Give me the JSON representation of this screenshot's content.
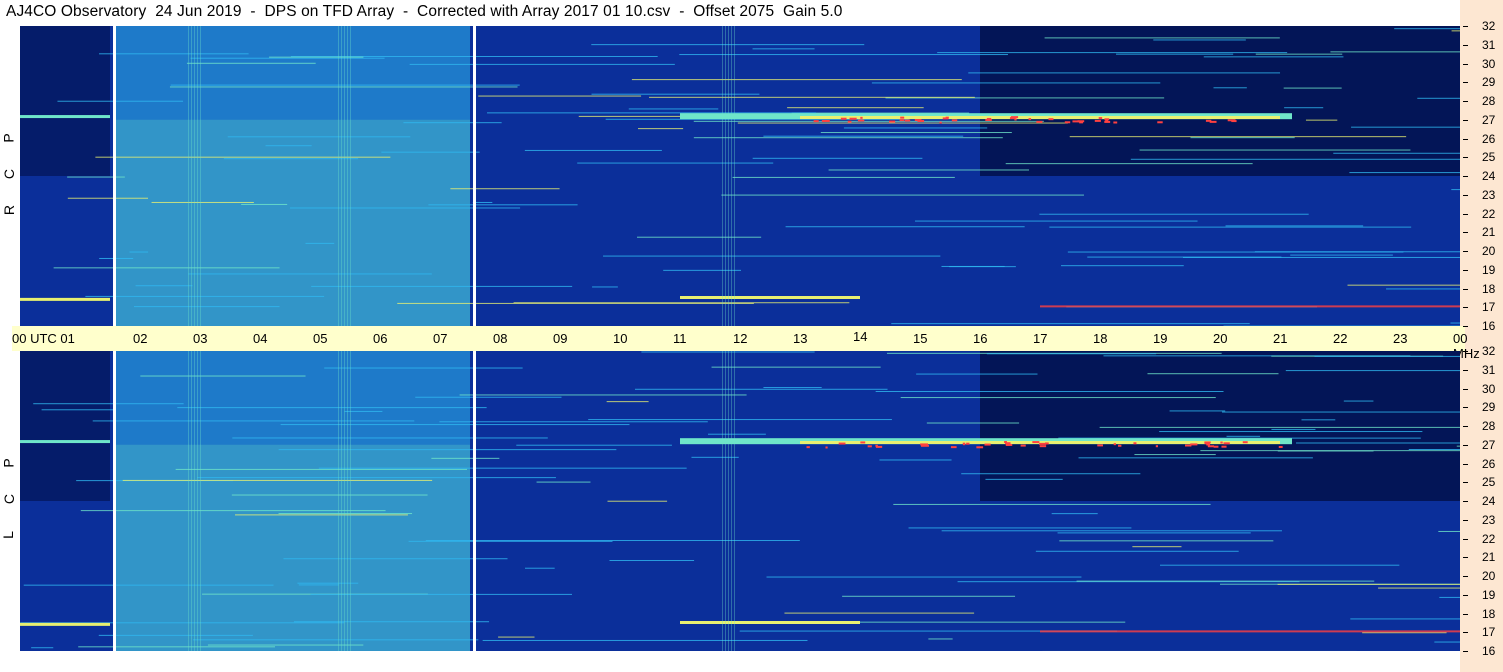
{
  "title": "AJ4CO Observatory  24 Jun 2019  -  DPS on TFD Array  -  Corrected with Array 2017 01 10.csv  -  Offset 2075  Gain 5.0",
  "colors": {
    "background": "#ffffff",
    "axis_strip": "#ffffcc",
    "freq_strip": "#fde7d2",
    "colormap": [
      "#000a3a",
      "#0b2f9a",
      "#1f6fe0",
      "#2fb8f0",
      "#6fe6c9",
      "#e8f070",
      "#ff4040"
    ]
  },
  "panels": {
    "rcp": {
      "label": [
        "R",
        "C",
        "P"
      ]
    },
    "lcp": {
      "label": [
        "L",
        "C",
        "P"
      ]
    }
  },
  "time_axis": {
    "labels": [
      "00 UTC 01",
      "02",
      "03",
      "04",
      "05",
      "06",
      "07",
      "08",
      "09",
      "10",
      "11",
      "12",
      "13",
      "14",
      "15",
      "16",
      "17",
      "18",
      "19",
      "20",
      "21",
      "22",
      "23",
      "00 MHz"
    ]
  },
  "freq_axis": {
    "labels": [
      "32",
      "31",
      "30",
      "29",
      "28",
      "27",
      "26",
      "25",
      "24",
      "23",
      "22",
      "21",
      "20",
      "19",
      "18",
      "17",
      "16"
    ]
  },
  "chart_data": {
    "type": "heatmap",
    "title": "AJ4CO Observatory  24 Jun 2019  -  DPS on TFD Array  -  Corrected with Array 2017 01 10.csv  -  Offset 2075  Gain 5.0",
    "x": {
      "unit": "UTC hour",
      "range": [
        0,
        24
      ],
      "ticks": [
        "00",
        "01",
        "02",
        "03",
        "04",
        "05",
        "06",
        "07",
        "08",
        "09",
        "10",
        "11",
        "12",
        "13",
        "14",
        "15",
        "16",
        "17",
        "18",
        "19",
        "20",
        "21",
        "22",
        "23",
        "00"
      ]
    },
    "y": {
      "unit": "MHz",
      "range": [
        16,
        32
      ],
      "ticks": [
        16,
        17,
        18,
        19,
        20,
        21,
        22,
        23,
        24,
        25,
        26,
        27,
        28,
        29,
        30,
        31,
        32
      ]
    },
    "panels": [
      {
        "name": "RCP"
      },
      {
        "name": "LCP"
      }
    ],
    "features": {
      "bright_band_mhz": 27.1,
      "bright_band_hours": [
        11,
        21.2
      ],
      "data_gaps_hours": [
        1.55,
        7.55
      ],
      "interference_hours": [
        2.8,
        5.3,
        11.7
      ],
      "quiet_hours": [
        1.6,
        7.5
      ]
    },
    "grid": false,
    "legend": "none"
  }
}
